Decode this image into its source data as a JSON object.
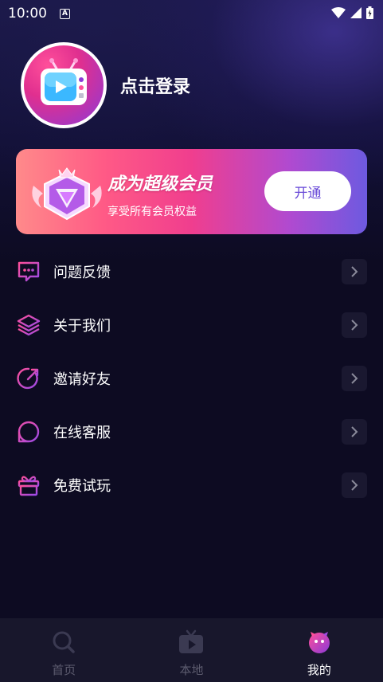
{
  "status_bar": {
    "time": "10:00",
    "notification_icon": "A"
  },
  "profile": {
    "login_text": "点击登录",
    "avatar_icon": "tv-mascot-icon"
  },
  "vip_card": {
    "title": "成为超级会员",
    "subtitle": "享受所有会员权益",
    "button_label": "开通"
  },
  "menu": {
    "items": [
      {
        "label": "问题反馈",
        "icon": "feedback-icon"
      },
      {
        "label": "关于我们",
        "icon": "layers-icon"
      },
      {
        "label": "邀请好友",
        "icon": "share-icon"
      },
      {
        "label": "在线客服",
        "icon": "chat-icon"
      },
      {
        "label": "免费试玩",
        "icon": "gift-icon"
      }
    ]
  },
  "tabbar": {
    "tabs": [
      {
        "label": "首页",
        "icon": "search-icon",
        "active": false
      },
      {
        "label": "本地",
        "icon": "tv-play-icon",
        "active": false
      },
      {
        "label": "我的",
        "icon": "mascot-icon",
        "active": true
      }
    ]
  },
  "colors": {
    "accent_pink": "#f03e8e",
    "accent_purple": "#6d5ae0",
    "background": "#0d0b22",
    "tabbar": "#18172c"
  }
}
